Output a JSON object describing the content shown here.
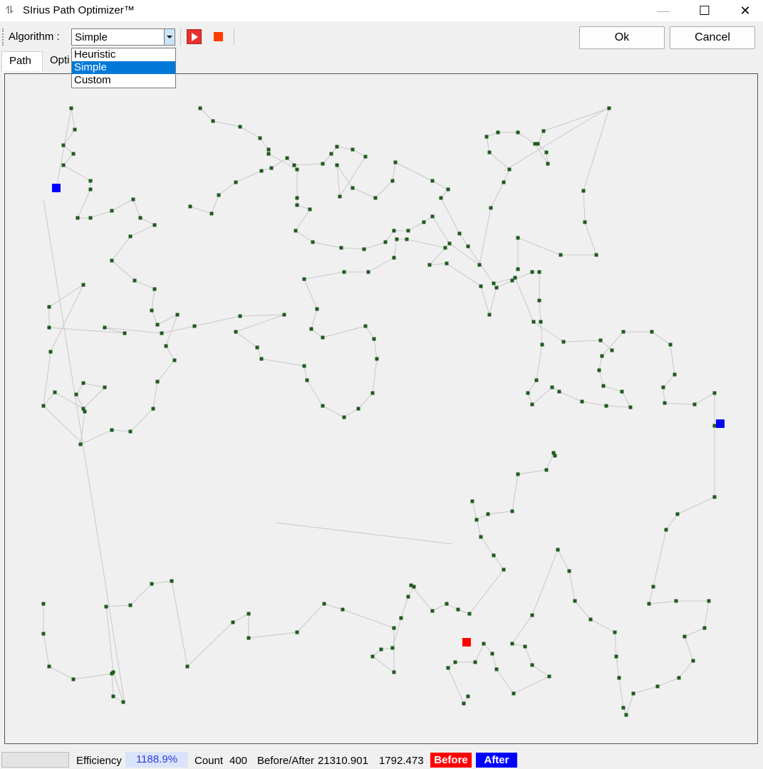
{
  "window": {
    "title": "SIrius Path Optimizer™",
    "icon": "path-icon"
  },
  "toolbar": {
    "algorithm_label": "Algorithm :",
    "algorithm_value": "Simple",
    "ok_label": "Ok",
    "cancel_label": "Cancel"
  },
  "dropdown": {
    "options": [
      "Heuristic",
      "Simple",
      "Custom"
    ],
    "selected_index": 1
  },
  "tabs": [
    {
      "label": "Path"
    },
    {
      "label": "Opti"
    }
  ],
  "colors": {
    "node": "#1f5a1f",
    "path_line": "#c8c8c8",
    "start_marker": "#0000ff",
    "end_marker": "#ff0000",
    "before": "#ff0000",
    "after": "#0000ff"
  },
  "status": {
    "efficiency_label": "Efficiency",
    "efficiency_value": "1188.9%",
    "count_label": "Count",
    "count_value": "400",
    "before_after_label": "Before/After",
    "before_value": "21310.901",
    "after_value": "1792.473",
    "before_label": "Before",
    "after_label": "After"
  }
}
